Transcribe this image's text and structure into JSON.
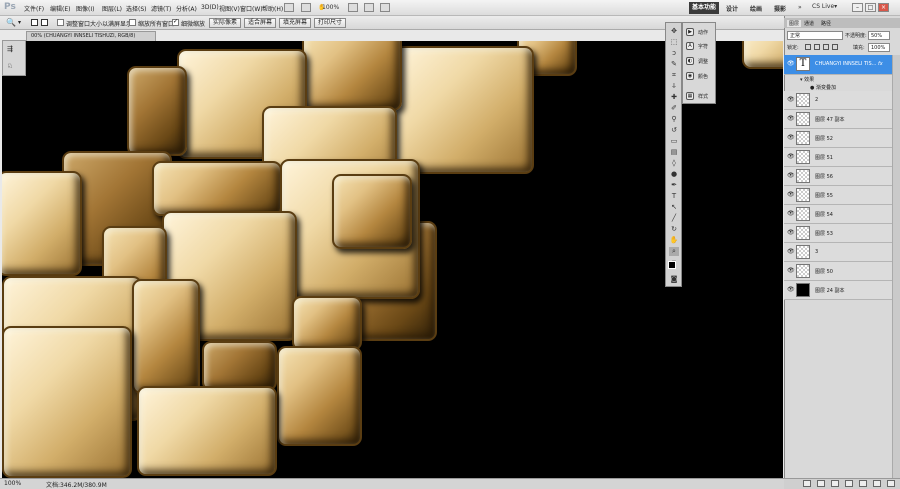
{
  "app": {
    "logo": "Ps"
  },
  "menu": [
    "文件(F)",
    "编辑(E)",
    "图像(I)",
    "图层(L)",
    "选择(S)",
    "滤镜(T)",
    "分析(A)",
    "3D(D)",
    "视图(V)",
    "窗口(W)",
    "帮助(H)"
  ],
  "menubar_zoom": "100%",
  "workspaces": {
    "active": "基本功能",
    "items": [
      "设计",
      "绘画",
      "摄影"
    ]
  },
  "cslive": "CS Live▾",
  "options": {
    "resize_window": "调整窗口大小以满屏显示",
    "zoom_all": "缩放所有窗口",
    "scrubby_zoom": "细微缩放",
    "btn_actual": "实际像素",
    "btn_fit": "适合屏幕",
    "btn_fill": "填充屏幕",
    "btn_print": "打印尺寸"
  },
  "document": {
    "tab_title": "00% (CHUANGYI INNSELI TISHUZI, RGB/8)"
  },
  "status": {
    "zoom": "100%",
    "doc_size": "文档:346.2M/380.9M"
  },
  "adjust_panel": [
    "动作",
    "字符",
    "调整",
    "颜色",
    "样式"
  ],
  "layers_panel": {
    "tabs": [
      "图层",
      "通道",
      "路径"
    ],
    "blend_mode": "正常",
    "opacity_label": "不透明度:",
    "opacity": "50%",
    "lock_label": "锁定:",
    "fill_label": "填充:",
    "fill": "100%",
    "layers": [
      {
        "name": "CHUANGYI INNSELI TIS...",
        "type": "text",
        "selected": true,
        "fx": "fx"
      },
      {
        "name": "2",
        "type": "pixel"
      },
      {
        "name": "图层 47 副本",
        "type": "pixel"
      },
      {
        "name": "图层 52",
        "type": "pixel"
      },
      {
        "name": "图层 51",
        "type": "pixel"
      },
      {
        "name": "图层 56",
        "type": "pixel"
      },
      {
        "name": "图层 55",
        "type": "pixel"
      },
      {
        "name": "图层 54",
        "type": "pixel"
      },
      {
        "name": "图层 53",
        "type": "pixel"
      },
      {
        "name": "3",
        "type": "pixel"
      },
      {
        "name": "图层 50",
        "type": "pixel"
      },
      {
        "name": "图层 24 副本",
        "type": "black"
      }
    ],
    "effects_label": "效果",
    "effect_item": "渐变叠加"
  }
}
